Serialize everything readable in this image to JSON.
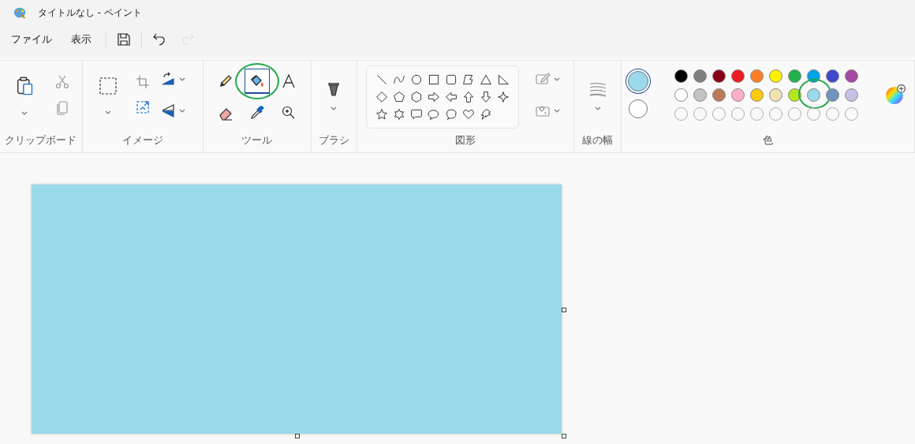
{
  "window": {
    "title": "タイトルなし - ペイント"
  },
  "menu": [
    {
      "label": "ファイル"
    },
    {
      "label": "表示"
    }
  ],
  "quick_access": [
    {
      "kind": "save",
      "disabled": false
    },
    {
      "kind": "undo",
      "disabled": false
    },
    {
      "kind": "redo",
      "disabled": true
    }
  ],
  "ribbon": {
    "groups": [
      {
        "kind": "clipboard",
        "label": "クリップボード"
      },
      {
        "kind": "image",
        "label": "イメージ"
      },
      {
        "kind": "tools",
        "label": "ツール"
      },
      {
        "kind": "brush",
        "label": "ブラシ"
      },
      {
        "kind": "shapes",
        "label": "図形"
      },
      {
        "kind": "width",
        "label": "線の幅"
      },
      {
        "kind": "colors",
        "label": "色"
      }
    ],
    "tools": [
      {
        "kind": "pencil",
        "selected": false,
        "circled": false
      },
      {
        "kind": "fill",
        "selected": true,
        "circled": true
      },
      {
        "kind": "text",
        "selected": false,
        "circled": false
      },
      {
        "kind": "eraser",
        "selected": false,
        "circled": false
      },
      {
        "kind": "picker",
        "selected": false,
        "circled": false
      },
      {
        "kind": "magnifier",
        "selected": false,
        "circled": false
      }
    ],
    "shapes": [
      {
        "kind": "line"
      },
      {
        "kind": "curve"
      },
      {
        "kind": "oval"
      },
      {
        "kind": "rectangle"
      },
      {
        "kind": "rounded"
      },
      {
        "kind": "polygon"
      },
      {
        "kind": "triangle"
      },
      {
        "kind": "right-triangle"
      },
      {
        "kind": "diamond"
      },
      {
        "kind": "pentagon"
      },
      {
        "kind": "hexagon"
      },
      {
        "kind": "arrow-right"
      },
      {
        "kind": "arrow-left"
      },
      {
        "kind": "arrow-up"
      },
      {
        "kind": "arrow-down"
      },
      {
        "kind": "star4"
      },
      {
        "kind": "star5"
      },
      {
        "kind": "star6"
      },
      {
        "kind": "callout-rect"
      },
      {
        "kind": "callout-oval"
      },
      {
        "kind": "callout-cloud"
      },
      {
        "kind": "heart"
      },
      {
        "kind": "lightning"
      }
    ],
    "current_colors": [
      {
        "color": "#99d9ea",
        "selected": true
      },
      {
        "color": "#ffffff",
        "selected": false
      }
    ],
    "palette": [
      {
        "kind": "color",
        "color": "#000000",
        "circled": false
      },
      {
        "kind": "color",
        "color": "#7f7f7f",
        "circled": false
      },
      {
        "kind": "color",
        "color": "#880015",
        "circled": false
      },
      {
        "kind": "color",
        "color": "#ed1c24",
        "circled": false
      },
      {
        "kind": "color",
        "color": "#ff7f27",
        "circled": false
      },
      {
        "kind": "color",
        "color": "#fff200",
        "circled": false
      },
      {
        "kind": "color",
        "color": "#22b14c",
        "circled": false
      },
      {
        "kind": "color",
        "color": "#00a2e8",
        "circled": false
      },
      {
        "kind": "color",
        "color": "#3f48cc",
        "circled": false
      },
      {
        "kind": "color",
        "color": "#a349a4",
        "circled": false
      },
      {
        "kind": "color",
        "color": "#ffffff",
        "circled": false
      },
      {
        "kind": "color",
        "color": "#c3c3c3",
        "circled": false
      },
      {
        "kind": "color",
        "color": "#b97a57",
        "circled": false
      },
      {
        "kind": "color",
        "color": "#ffaec9",
        "circled": false
      },
      {
        "kind": "color",
        "color": "#ffc90e",
        "circled": false
      },
      {
        "kind": "color",
        "color": "#efe4b0",
        "circled": false
      },
      {
        "kind": "color",
        "color": "#b5e61d",
        "circled": false
      },
      {
        "kind": "color",
        "color": "#99d9ea",
        "circled": true
      },
      {
        "kind": "color",
        "color": "#7092be",
        "circled": false
      },
      {
        "kind": "color",
        "color": "#c8bfe7",
        "circled": false
      },
      {
        "kind": "empty"
      },
      {
        "kind": "empty"
      },
      {
        "kind": "empty"
      },
      {
        "kind": "empty"
      },
      {
        "kind": "empty"
      },
      {
        "kind": "empty"
      },
      {
        "kind": "empty"
      },
      {
        "kind": "empty"
      },
      {
        "kind": "empty"
      },
      {
        "kind": "empty"
      }
    ]
  }
}
